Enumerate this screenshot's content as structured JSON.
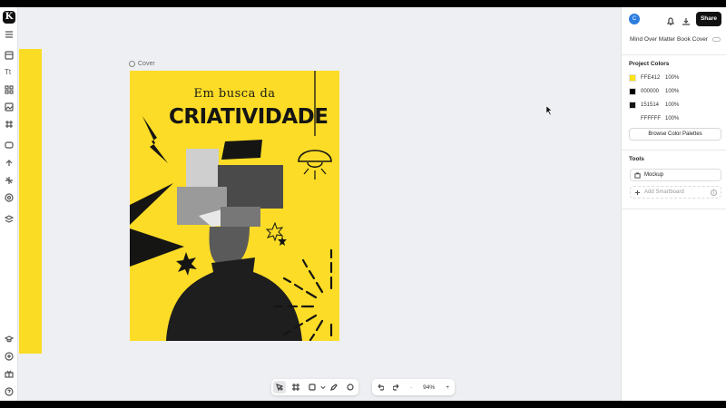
{
  "app": {
    "logo_letter": "K"
  },
  "left_toolbar": {
    "text_tool": "Tt",
    "icons": [
      "hamburger-menu-icon",
      "layout-icon",
      "text-icon",
      "elements-icon",
      "image-icon",
      "grid-icon",
      "shape-icon",
      "upload-icon",
      "magic-icon",
      "brand-icon",
      "layers-icon",
      "learn-icon",
      "add-icon",
      "gift-icon",
      "help-icon"
    ]
  },
  "canvas": {
    "frame_label": "Cover",
    "cover": {
      "subtitle": "Em busca da",
      "title": "CRIATIVIDADE",
      "background": "#FCDC26"
    }
  },
  "right_panel": {
    "avatar_initial": "C",
    "share_label": "Share",
    "document_title": "Mind Over Matter Book Cover",
    "project_colors_title": "Project Colors",
    "colors": [
      {
        "hex": "FFE412",
        "opacity": "100%",
        "swatch": "#FFE412"
      },
      {
        "hex": "000000",
        "opacity": "100%",
        "swatch": "#000000"
      },
      {
        "hex": "151514",
        "opacity": "100%",
        "swatch": "#151514"
      },
      {
        "hex": "FFFFFF",
        "opacity": "100%",
        "swatch": "#FFFFFF"
      }
    ],
    "browse_button": "Browse Color Palettes",
    "tools_title": "Tools",
    "tools": [
      {
        "label": "Mockup",
        "icon": "mockup-icon"
      },
      {
        "label": "Add Smartboard",
        "icon": "plus-icon"
      }
    ]
  },
  "bottom_toolbar": {
    "zoom_level": "94%",
    "zoom_minus": "-",
    "zoom_plus": "+"
  }
}
